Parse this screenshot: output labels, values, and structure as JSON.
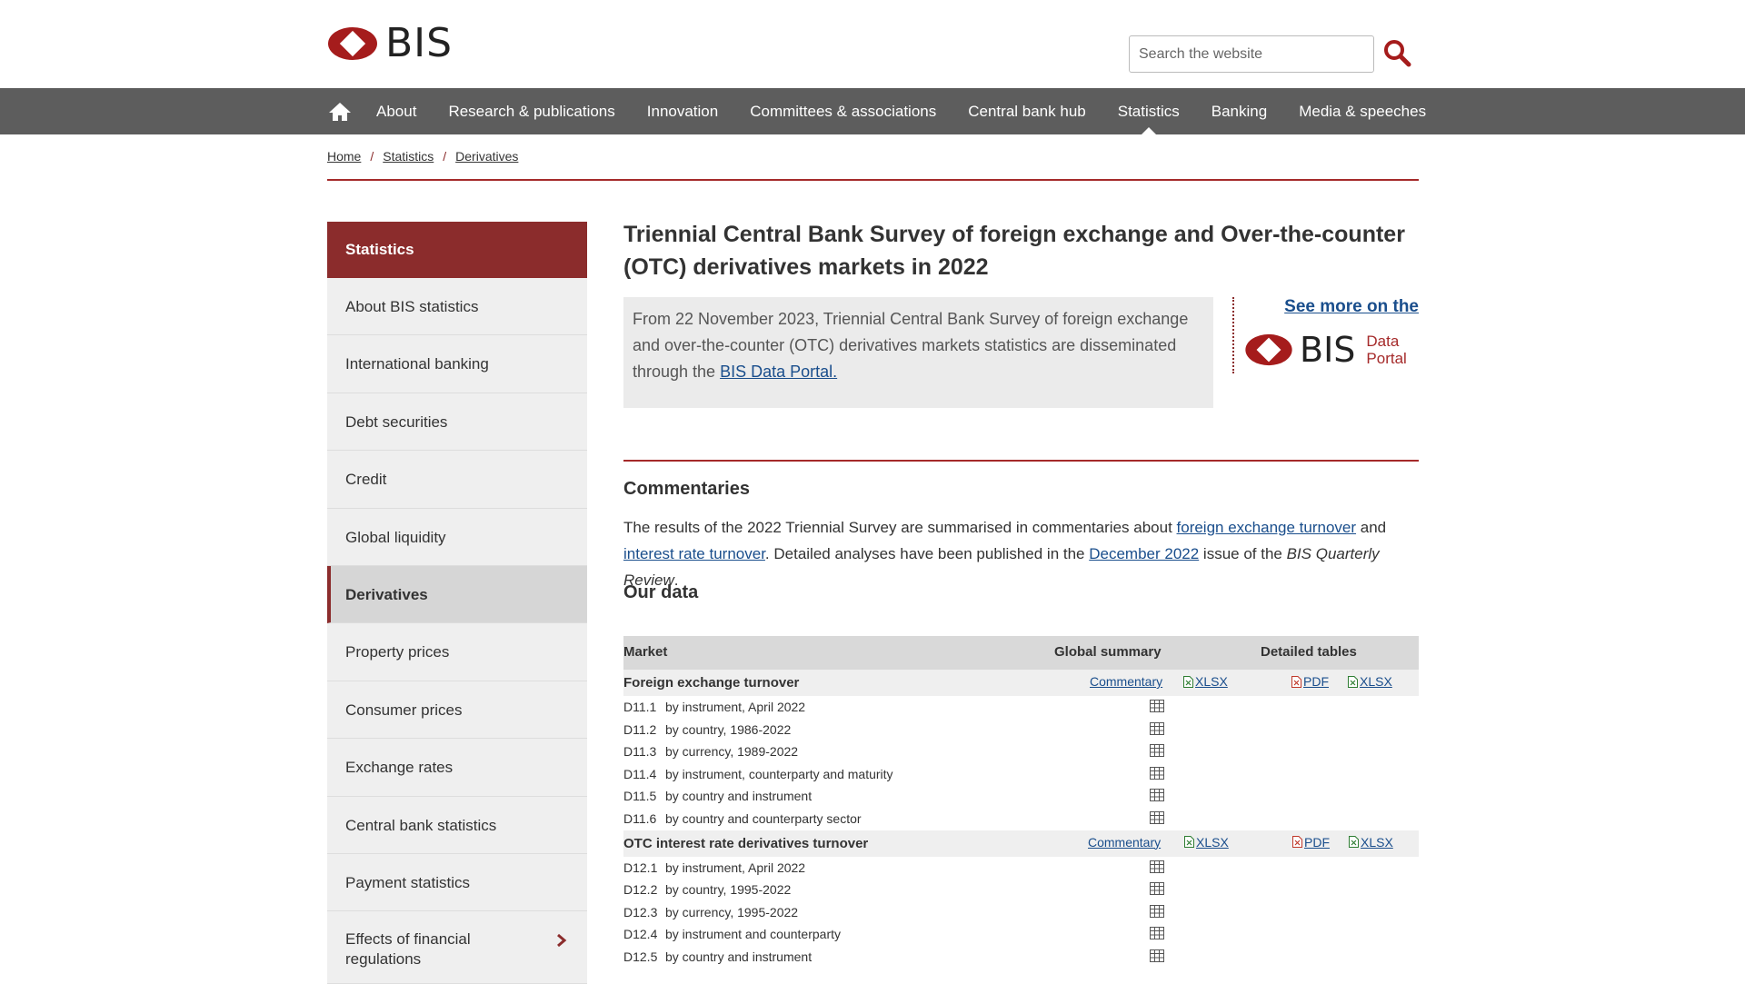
{
  "header": {
    "logo_text": "BIS",
    "search_placeholder": "Search the website"
  },
  "nav": {
    "items": [
      "About",
      "Research & publications",
      "Innovation",
      "Committees & associations",
      "Central bank hub",
      "Statistics",
      "Banking",
      "Media & speeches"
    ],
    "active": "Statistics"
  },
  "breadcrumb": [
    "Home",
    "Statistics",
    "Derivatives"
  ],
  "sidebar": {
    "heading": "Statistics",
    "items": [
      "About BIS statistics",
      "International banking",
      "Debt securities",
      "Credit",
      "Global liquidity",
      "Derivatives",
      "Property prices",
      "Consumer prices",
      "Exchange rates",
      "Central bank statistics",
      "Payment statistics",
      "Effects of financial regulations"
    ],
    "active": "Derivatives"
  },
  "main": {
    "title": "Triennial Central Bank Survey of foreign exchange and Over-the-counter (OTC) derivatives markets in 2022",
    "notice_text": "From 22 November 2023, Triennial Central Bank Survey of foreign exchange and over-the-counter (OTC) derivatives markets statistics are disseminated through the ",
    "notice_link": "BIS Data Portal.",
    "portal_link": "See more on the",
    "portal_logo": "BIS",
    "portal_data": "Data",
    "portal_portal": "Portal",
    "commentaries_heading": "Commentaries",
    "commentaries_p1": "The results of the 2022 Triennial Survey are summarised in commentaries about ",
    "link_fx": "foreign exchange turnover",
    "commentaries_and": " and",
    "link_ir": "interest rate turnover",
    "commentaries_p2": ". Detailed analyses have been published in the ",
    "link_dec": "December 2022",
    "commentaries_p3": " issue of the ",
    "qr_title": "BIS Quarterly Review",
    "commentaries_end": ".",
    "data_heading": "Our data"
  },
  "table": {
    "headers": {
      "market": "Market",
      "global": "Global summary",
      "detailed": "Detailed tables"
    },
    "link_labels": {
      "commentary": "Commentary",
      "xlsx": "XLSX",
      "pdf": "PDF"
    },
    "groups": [
      {
        "name": "Foreign exchange turnover",
        "rows": [
          {
            "code": "D11.1",
            "desc": "by instrument, April 2022"
          },
          {
            "code": "D11.2",
            "desc": "by country, 1986-2022"
          },
          {
            "code": "D11.3",
            "desc": "by currency, 1989-2022"
          },
          {
            "code": "D11.4",
            "desc": "by instrument, counterparty and maturity"
          },
          {
            "code": "D11.5",
            "desc": "by country and instrument"
          },
          {
            "code": "D11.6",
            "desc": "by country and counterparty sector"
          }
        ]
      },
      {
        "name": "OTC interest rate derivatives turnover",
        "rows": [
          {
            "code": "D12.1",
            "desc": "by instrument, April 2022"
          },
          {
            "code": "D12.2",
            "desc": "by country, 1995-2022"
          },
          {
            "code": "D12.3",
            "desc": "by currency, 1995-2022"
          },
          {
            "code": "D12.4",
            "desc": "by instrument and counterparty"
          },
          {
            "code": "D12.5",
            "desc": "by country and instrument"
          }
        ]
      }
    ]
  },
  "colors": {
    "brand": "#8b2c2c",
    "nav_bg": "#5d5d5d",
    "link": "#1a4e8c",
    "xlsx": "#2e7d32",
    "pdf": "#c0392b"
  },
  "icons": [
    "home-icon",
    "search-icon",
    "table-icon",
    "xlsx-file-icon",
    "pdf-file-icon",
    "chevron-right-icon"
  ]
}
